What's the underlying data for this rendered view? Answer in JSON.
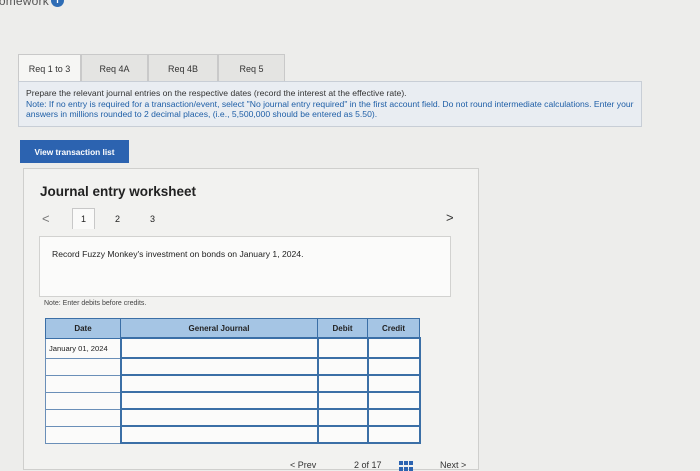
{
  "header": {
    "title": "lomework",
    "info_icon": "i"
  },
  "tabs": [
    {
      "label": "Req 1 to 3",
      "active": true
    },
    {
      "label": "Req 4A",
      "active": false
    },
    {
      "label": "Req 4B",
      "active": false
    },
    {
      "label": "Req 5",
      "active": false
    }
  ],
  "instructions": {
    "main": "Prepare the relevant journal entries on the respective dates (record the interest at the effective rate).",
    "note": "Note: If no entry is required for a transaction/event, select \"No journal entry required\" in the first account field. Do not round intermediate calculations. Enter your answers in millions rounded to 2 decimal places, (i.e., 5,500,000 should be entered as 5.50)."
  },
  "view_button": "View transaction list",
  "worksheet": {
    "title": "Journal entry worksheet",
    "prev": "<",
    "next": ">",
    "pages": [
      "1",
      "2",
      "3"
    ],
    "active_page": "1",
    "description": "Record Fuzzy Monkey's investment on bonds on January 1, 2024.",
    "note": "Note: Enter debits before credits."
  },
  "journal_table": {
    "headers": [
      "Date",
      "General Journal",
      "Debit",
      "Credit"
    ],
    "rows": [
      {
        "date": "January 01, 2024"
      },
      {
        "date": ""
      },
      {
        "date": ""
      },
      {
        "date": ""
      },
      {
        "date": ""
      },
      {
        "date": ""
      }
    ]
  },
  "footer": {
    "prev": "< Prev",
    "page_info": "2 of 17",
    "next": "Next >"
  },
  "colors": {
    "accent": "#2c63b0",
    "table_header": "#a5c5e4",
    "instructions_bg": "#e9edf2"
  }
}
